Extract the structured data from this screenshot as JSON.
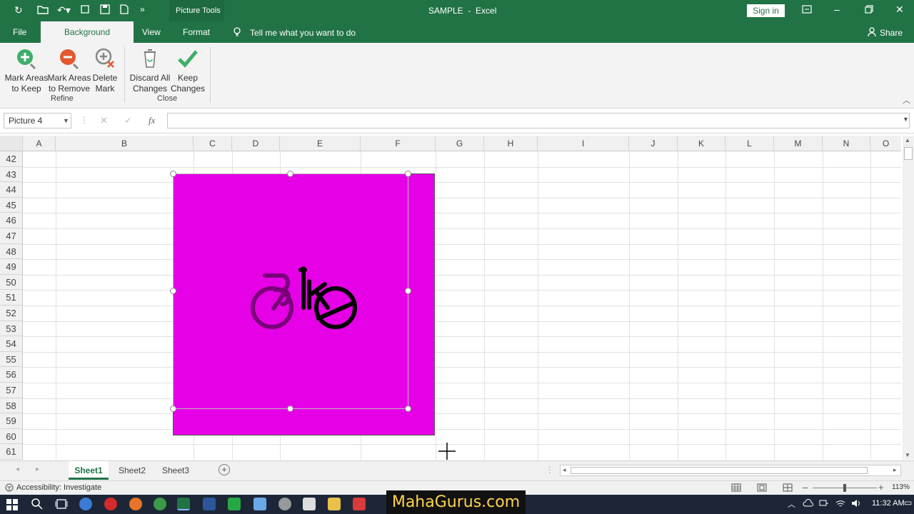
{
  "window": {
    "title": "SAMPLE  -  Excel",
    "context_label": "Picture Tools",
    "sign_in": "Sign in",
    "share": "Share"
  },
  "tabs": [
    {
      "label": "File"
    },
    {
      "label": "Background Removal"
    },
    {
      "label": "View"
    },
    {
      "label": "Format"
    }
  ],
  "tell_me": "Tell me what you want to do",
  "ribbon": {
    "buttons": [
      {
        "label1": "Mark Areas",
        "label2": "to Keep"
      },
      {
        "label1": "Mark Areas",
        "label2": "to Remove"
      },
      {
        "label1": "Delete",
        "label2": "Mark"
      },
      {
        "label1": "Discard All",
        "label2": "Changes"
      },
      {
        "label1": "Keep",
        "label2": "Changes"
      }
    ],
    "groups": [
      "Refine",
      "Close"
    ]
  },
  "formula": {
    "namebox": "Picture 4",
    "fx_label": "fx",
    "value": ""
  },
  "columns": [
    "A",
    "B",
    "C",
    "D",
    "E",
    "F",
    "G",
    "H",
    "I",
    "J",
    "K",
    "L",
    "M",
    "N",
    "O"
  ],
  "rows": [
    "42",
    "43",
    "44",
    "45",
    "46",
    "47",
    "48",
    "49",
    "50",
    "51",
    "52",
    "53",
    "54",
    "55",
    "56",
    "57",
    "58",
    "59",
    "60",
    "61"
  ],
  "picture": {
    "text": "Bike",
    "background_color": "#e600e6"
  },
  "sheets": [
    "Sheet1",
    "Sheet2",
    "Sheet3"
  ],
  "active_sheet": "Sheet1",
  "status": {
    "accessibility": "Accessibility: Investigate",
    "zoom": "113%"
  },
  "taskbar": {
    "time": "11:32 AM"
  },
  "watermark": "MahaGurus.com",
  "colors": {
    "excel_green": "#217346",
    "picture_magenta": "#e600e6"
  }
}
